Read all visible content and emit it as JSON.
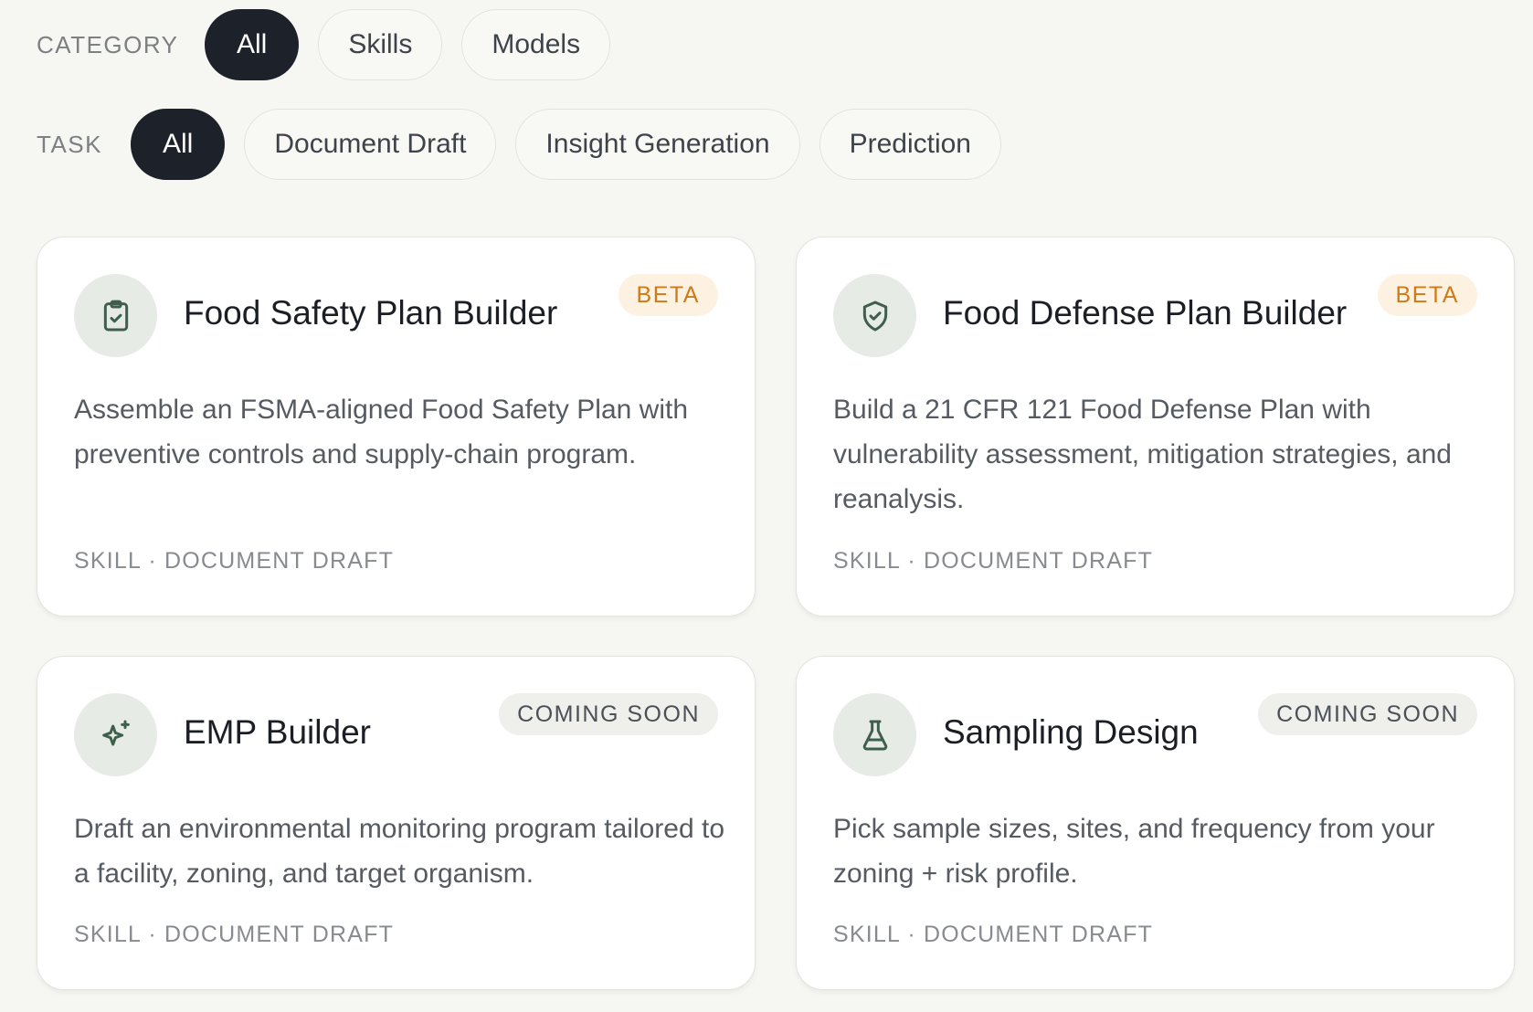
{
  "filters": {
    "category": {
      "label": "CATEGORY",
      "options": [
        "All",
        "Skills",
        "Models"
      ],
      "selected": "All"
    },
    "task": {
      "label": "TASK",
      "options": [
        "All",
        "Document Draft",
        "Insight Generation",
        "Prediction"
      ],
      "selected": "All"
    }
  },
  "cards": [
    {
      "icon": "clipboard-check-icon",
      "title": "Food Safety Plan Builder",
      "badge": "BETA",
      "description": "Assemble an FSMA-aligned Food Safety Plan with preventive controls and supply-chain program.",
      "meta": "SKILL · DOCUMENT DRAFT"
    },
    {
      "icon": "shield-check-icon",
      "title": "Food Defense Plan Builder",
      "badge": "BETA",
      "description": "Build a 21 CFR 121 Food Defense Plan with vulnerability assessment, mitigation strategies, and reanalysis.",
      "meta": "SKILL · DOCUMENT DRAFT"
    },
    {
      "icon": "sparkles-icon",
      "title": "EMP Builder",
      "badge": "COMING SOON",
      "description": "Draft an environmental monitoring program tailored to a facility, zoning, and target organism.",
      "meta": "SKILL · DOCUMENT DRAFT"
    },
    {
      "icon": "flask-icon",
      "title": "Sampling Design",
      "badge": "COMING SOON",
      "description": "Pick sample sizes, sites, and frequency from your zoning + risk profile.",
      "meta": "SKILL · DOCUMENT DRAFT"
    }
  ],
  "colors": {
    "background": "#f6f6f2",
    "chip_active": "#1d2129",
    "icon_green": "#3f5f4c",
    "beta_text": "#cf7a18",
    "beta_bg": "#fdf2e1"
  }
}
